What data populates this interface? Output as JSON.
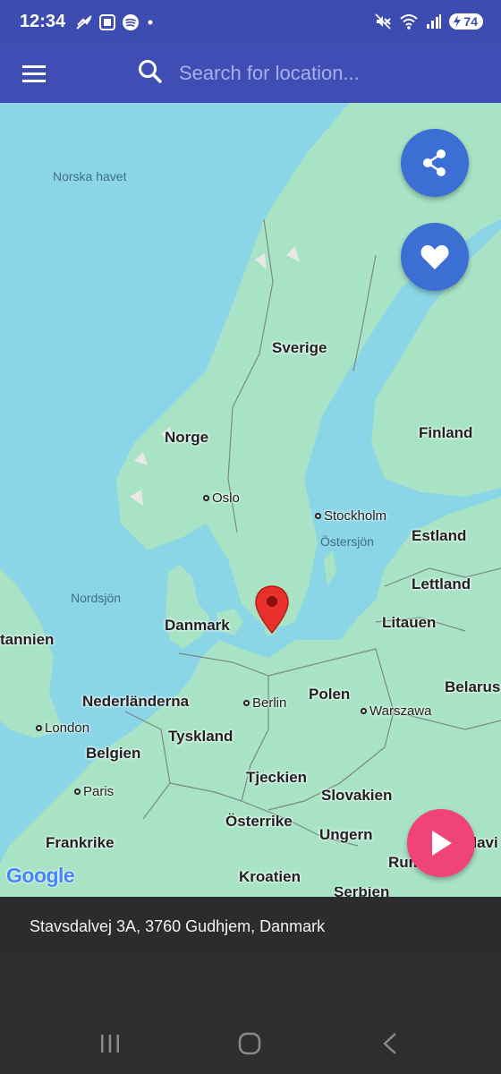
{
  "status_bar": {
    "time": "12:34",
    "battery": "74",
    "left_icons": [
      "missed-call-icon",
      "screenshot-icon",
      "spotify-icon",
      "dot-icon"
    ],
    "right_icons": [
      "mute-icon",
      "wifi-icon",
      "signal-icon"
    ]
  },
  "app_bar": {
    "search_placeholder": "Search for location..."
  },
  "map": {
    "sea_labels": [
      "Norska havet",
      "Nordsjön",
      "Östersjön"
    ],
    "country_labels": [
      "Sverige",
      "Finland",
      "Norge",
      "Estland",
      "Lettland",
      "Litauen",
      "Danmark",
      "tannien",
      "Nederländerna",
      "Polen",
      "Belarus",
      "Tyskland",
      "Belgien",
      "Tjeckien",
      "Slovakien",
      "Österrike",
      "Ungern",
      "Frankrike",
      "Kroatien",
      "Rum",
      "ldavi",
      "Serbien"
    ],
    "city_labels": [
      "Oslo",
      "Stockholm",
      "Berlin",
      "Warszawa",
      "London",
      "Paris"
    ],
    "attribution": "Google"
  },
  "fabs": {
    "share_color": "#3b6fd4",
    "favorite_color": "#3b6fd4",
    "play_color": "#f0437a"
  },
  "address": {
    "text": "Stavsdalvej 3A, 3760 Gudhjem, Danmark"
  },
  "nav": {
    "buttons": [
      "recent-apps-icon",
      "home-icon",
      "back-icon"
    ]
  },
  "colors": {
    "app_bar": "#3f4db5",
    "water": "#8ad5e6",
    "land": "#a8e3c6",
    "marker": "#e8312a"
  }
}
